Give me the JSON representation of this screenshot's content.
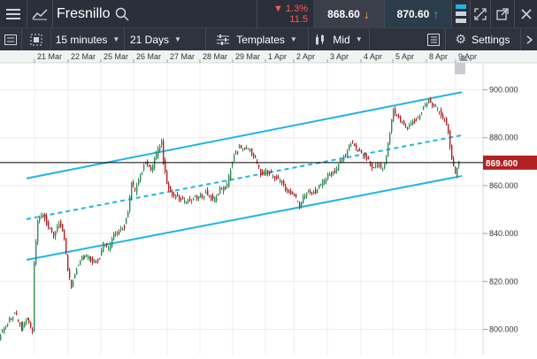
{
  "header": {
    "instrument": "Fresnillo",
    "change_pct": "▼ 1.3%",
    "change_abs": "11.5",
    "sell_price": "868.60",
    "buy_price": "870.60"
  },
  "toolbar": {
    "interval": "15 minutes",
    "period": "21 Days",
    "templates": "Templates",
    "price_type": "Mid",
    "settings": "Settings"
  },
  "chart_data": {
    "type": "line",
    "title": "",
    "x_tick_labels": [
      "21 Mar",
      "22 Mar",
      "25 Mar",
      "26 Mar",
      "27 Mar",
      "28 Mar",
      "29 Mar",
      "1 Apr",
      "2 Apr",
      "3 Apr",
      "4 Apr",
      "5 Apr",
      "8 Apr",
      "9 Apr"
    ],
    "y_tick_labels": [
      "900.000",
      "880.000",
      "860.000",
      "840.000",
      "820.000",
      "800.000"
    ],
    "ylim": [
      792,
      906
    ],
    "current_price_label": "869.600",
    "current_price": 869.6,
    "series": [
      {
        "values": [
          [
            0,
            797
          ],
          [
            10,
            803
          ],
          [
            18,
            807
          ],
          [
            25,
            801
          ],
          [
            32,
            804
          ],
          [
            38,
            799
          ],
          [
            40,
            827
          ],
          [
            44,
            845
          ],
          [
            50,
            848
          ],
          [
            56,
            842
          ],
          [
            62,
            839
          ],
          [
            68,
            845
          ],
          [
            74,
            838
          ],
          [
            78,
            825
          ],
          [
            82,
            818
          ],
          [
            88,
            826
          ],
          [
            95,
            831
          ],
          [
            102,
            830
          ],
          [
            108,
            828
          ],
          [
            114,
            830
          ],
          [
            118,
            836
          ],
          [
            124,
            834
          ],
          [
            130,
            839
          ],
          [
            136,
            841
          ],
          [
            142,
            843
          ],
          [
            146,
            849
          ],
          [
            150,
            861
          ],
          [
            154,
            858
          ],
          [
            160,
            864
          ],
          [
            166,
            870
          ],
          [
            172,
            866
          ],
          [
            178,
            873
          ],
          [
            184,
            878
          ],
          [
            186,
            870
          ],
          [
            190,
            860
          ],
          [
            196,
            856
          ],
          [
            202,
            855
          ],
          [
            210,
            853
          ],
          [
            218,
            854
          ],
          [
            226,
            855
          ],
          [
            234,
            857
          ],
          [
            242,
            854
          ],
          [
            250,
            858
          ],
          [
            258,
            860
          ],
          [
            262,
            867
          ],
          [
            266,
            873
          ],
          [
            272,
            876
          ],
          [
            280,
            876
          ],
          [
            288,
            873
          ],
          [
            292,
            869
          ],
          [
            296,
            865
          ],
          [
            302,
            866
          ],
          [
            310,
            864
          ],
          [
            318,
            862
          ],
          [
            326,
            858
          ],
          [
            334,
            856
          ],
          [
            340,
            852
          ],
          [
            346,
            856
          ],
          [
            352,
            858
          ],
          [
            358,
            857
          ],
          [
            364,
            861
          ],
          [
            372,
            864
          ],
          [
            380,
            866
          ],
          [
            386,
            870
          ],
          [
            392,
            873
          ],
          [
            398,
            878
          ],
          [
            404,
            876
          ],
          [
            410,
            873
          ],
          [
            416,
            872
          ],
          [
            422,
            867
          ],
          [
            428,
            869
          ],
          [
            434,
            867
          ],
          [
            438,
            872
          ],
          [
            442,
            882
          ],
          [
            446,
            892
          ],
          [
            450,
            889
          ],
          [
            456,
            886
          ],
          [
            462,
            884
          ],
          [
            468,
            887
          ],
          [
            474,
            888
          ],
          [
            480,
            893
          ],
          [
            486,
            896
          ],
          [
            492,
            893
          ],
          [
            498,
            891
          ],
          [
            504,
            887
          ],
          [
            508,
            882
          ],
          [
            512,
            872
          ],
          [
            516,
            864
          ],
          [
            520,
            870
          ]
        ]
      }
    ],
    "annotations": {
      "channel_upper": [
        [
          30,
          863
        ],
        [
          522,
          899
        ]
      ],
      "channel_mid": [
        [
          30,
          846
        ],
        [
          522,
          881
        ]
      ],
      "channel_lower": [
        [
          30,
          829
        ],
        [
          522,
          864
        ]
      ]
    },
    "colors": {
      "up_candle": "#2e8b57",
      "down_candle": "#b22222",
      "channel": "#1fb4e6",
      "price_label_bg": "#b22222",
      "sell_bg": "#3a3f4a",
      "buy_bg": "#2b3c4a",
      "change_red": "#ff5a4f"
    },
    "grid": true
  }
}
